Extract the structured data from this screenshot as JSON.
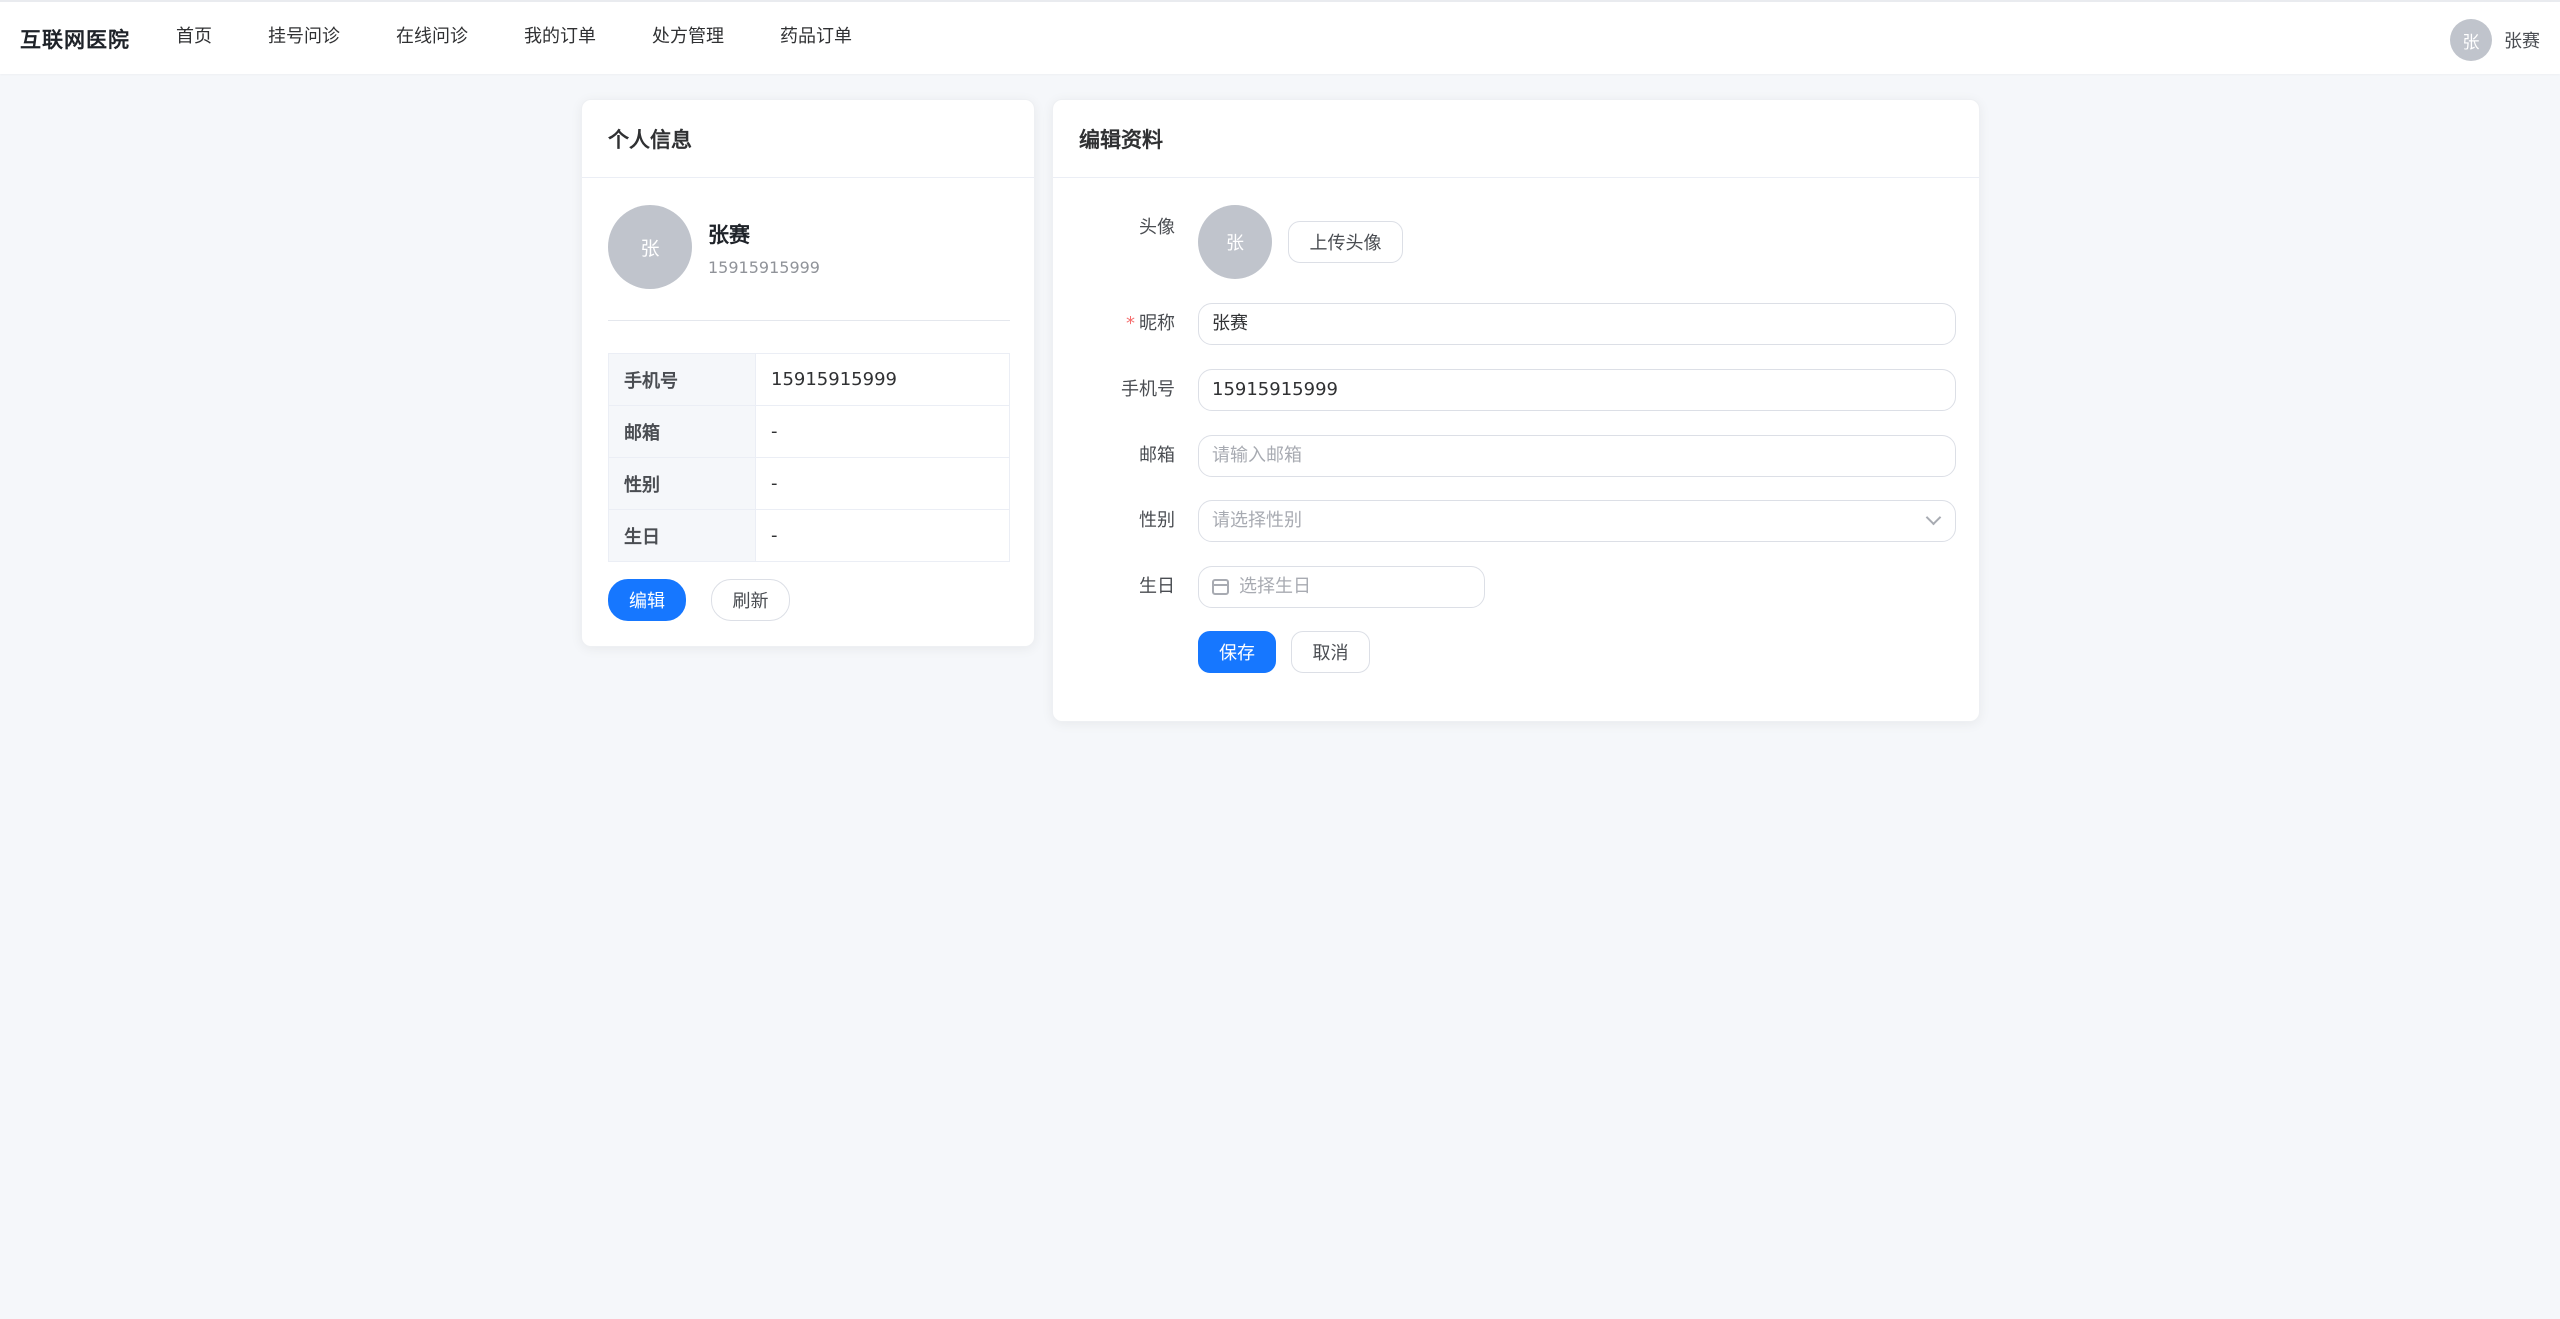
{
  "header": {
    "brand": "互联网医院",
    "nav": [
      "首页",
      "挂号问诊",
      "在线问诊",
      "我的订单",
      "处方管理",
      "药品订单"
    ],
    "user_avatar_char": "张",
    "user_name": "张赛"
  },
  "profile_card": {
    "title": "个人信息",
    "avatar_char": "张",
    "name": "张赛",
    "phone": "15915915999",
    "rows": [
      {
        "label": "手机号",
        "value": "15915915999"
      },
      {
        "label": "邮箱",
        "value": "-"
      },
      {
        "label": "性别",
        "value": "-"
      },
      {
        "label": "生日",
        "value": "-"
      }
    ],
    "edit_button": "编辑",
    "refresh_button": "刷新"
  },
  "edit_card": {
    "title": "编辑资料",
    "avatar_label": "头像",
    "avatar_char": "张",
    "upload_button": "上传头像",
    "required_mark": "*",
    "nickname_label": "昵称",
    "nickname_value": "张赛",
    "phone_label": "手机号",
    "phone_value": "15915915999",
    "email_label": "邮箱",
    "email_placeholder": "请输入邮箱",
    "gender_label": "性别",
    "gender_placeholder": "请选择性别",
    "birthday_label": "生日",
    "birthday_placeholder": "选择生日",
    "save_button": "保存",
    "cancel_button": "取消"
  },
  "colors": {
    "primary": "#1677ff",
    "avatar_bg": "#c0c4cc",
    "page_bg": "#f5f7fa",
    "required": "#f56c6c"
  }
}
